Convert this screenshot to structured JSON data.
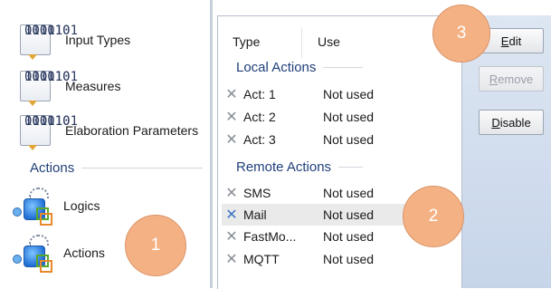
{
  "nav": {
    "items": [
      {
        "label": "Input Types",
        "icon": "binary-data-icon"
      },
      {
        "label": "Measures",
        "icon": "binary-data-icon"
      },
      {
        "label": "Elaboration Parameters",
        "icon": "binary-data-icon"
      }
    ],
    "section_title": "Actions",
    "action_items": [
      {
        "label": "Logics",
        "icon": "logic-icon"
      },
      {
        "label": "Actions",
        "icon": "actions-icon"
      }
    ]
  },
  "list": {
    "columns": {
      "type": "Type",
      "use": "Use"
    },
    "groups": [
      {
        "title": "Local Actions",
        "rows": [
          {
            "name": "Act: 1",
            "use": "Not used"
          },
          {
            "name": "Act: 2",
            "use": "Not used"
          },
          {
            "name": "Act: 3",
            "use": "Not used"
          }
        ]
      },
      {
        "title": "Remote Actions",
        "rows": [
          {
            "name": "SMS",
            "use": "Not used"
          },
          {
            "name": "Mail",
            "use": "Not used",
            "selected": true
          },
          {
            "name": "FastMo...",
            "use": "Not used"
          },
          {
            "name": "MQTT",
            "use": "Not used"
          }
        ]
      }
    ]
  },
  "buttons": {
    "edit": {
      "prefix": "",
      "accel": "E",
      "rest": "dit",
      "enabled": true
    },
    "remove": {
      "prefix": "",
      "accel": "R",
      "rest": "emove",
      "enabled": false
    },
    "disable": {
      "prefix": "",
      "accel": "D",
      "rest": "isable",
      "enabled": true
    }
  },
  "callouts": [
    "1",
    "2",
    "3"
  ],
  "colors": {
    "section_title": "#1f3f7a",
    "callout_fill": "#f4b183",
    "button_panel": "#c7d5ea",
    "selected_row": "#eaeaea"
  }
}
